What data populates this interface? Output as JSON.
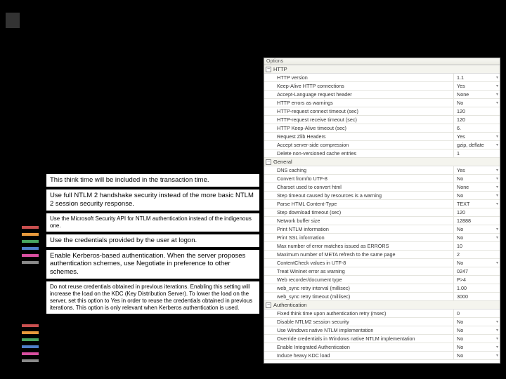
{
  "annotations": [
    "This think time will be included in the transaction time.",
    "Use full NTLM 2 handshake security instead of the more basic NTLM 2 session security response.",
    "Use the Microsoft Security API for NTLM authentication instead of the indigenous one.",
    "Use the credentials provided by the user at logon.",
    "Enable Kerberos-based authentication. When the server proposes authentication schemes, use Negotiate in preference to other schemes.",
    "Do not reuse credentials obtained in previous iterations. Enabling this setting will increase the load on the KDC (Key Distribution Server). To lower the load on the server, set this option to Yes in order to reuse the credentials obtained in previous iterations. This option is only relevant when Kerberos authentication is used."
  ],
  "panel": {
    "header": "Options",
    "groups": [
      {
        "name": "HTTP",
        "rows": [
          {
            "k": "HTTP version",
            "v": "1.1",
            "dd": true
          },
          {
            "k": "Keep-Alive HTTP connections",
            "v": "Yes",
            "dd": true
          },
          {
            "k": "Accept-Language request header",
            "v": "None",
            "dd": true
          },
          {
            "k": "HTTP errors as warnings",
            "v": "No",
            "dd": true
          },
          {
            "k": "HTTP-request connect timeout (sec)",
            "v": "120"
          },
          {
            "k": "HTTP-request receive timeout (sec)",
            "v": "120"
          },
          {
            "k": "HTTP Keep-Alive timeout (sec)",
            "v": "6."
          },
          {
            "k": "Request Zlib Headers",
            "v": "Yes",
            "dd": true
          },
          {
            "k": "Accept server-side compression",
            "v": "gzip, deflate",
            "dd": true
          },
          {
            "k": "Delete non-versioned cache entries",
            "v": "1"
          }
        ]
      },
      {
        "name": "General",
        "rows": [
          {
            "k": "DNS caching",
            "v": "Yes",
            "dd": true
          },
          {
            "k": "Convert from/to UTF-8",
            "v": "No",
            "dd": true
          },
          {
            "k": "Charset used to convert html",
            "v": "None",
            "dd": true
          },
          {
            "k": "Step timeout caused by resources is a warning",
            "v": "No",
            "dd": true
          },
          {
            "k": "Parse HTML Content-Type",
            "v": "TEXT",
            "dd": true
          },
          {
            "k": "Step download timeout (sec)",
            "v": "120"
          },
          {
            "k": "Network buffer size",
            "v": "12888"
          },
          {
            "k": "Print NTLM information",
            "v": "No",
            "dd": true
          },
          {
            "k": "Print SSL information",
            "v": "No",
            "dd": true
          },
          {
            "k": "Max number of error matches issued as ERRORS",
            "v": "10"
          },
          {
            "k": "Maximum number of META refresh to the same page",
            "v": "2"
          },
          {
            "k": "ContentCheck values in UTF-8",
            "v": "No",
            "dd": true
          },
          {
            "k": "Treat WinInet error as warning",
            "v": "0247"
          },
          {
            "k": "Web recorder/document type",
            "v": "P>4"
          },
          {
            "k": "web_sync retry interval (millisec)",
            "v": "1.00"
          },
          {
            "k": "web_sync retry timeout (millisec)",
            "v": "3000"
          }
        ]
      },
      {
        "name": "Authentication",
        "rows": [
          {
            "k": "Fixed think time upon authentication retry (msec)",
            "v": "0"
          },
          {
            "k": "Disable NTLM2 session security",
            "v": "No",
            "dd": true
          },
          {
            "k": "Use Windows native NTLM implementation",
            "v": "No",
            "dd": true
          },
          {
            "k": "Override credentials in Windows native NTLM implementation",
            "v": "No",
            "dd": true
          },
          {
            "k": "Enable Integrated Authentication",
            "v": "No",
            "dd": true
          },
          {
            "k": "Induce heavy KDC load",
            "v": "No",
            "dd": true
          }
        ]
      }
    ]
  }
}
